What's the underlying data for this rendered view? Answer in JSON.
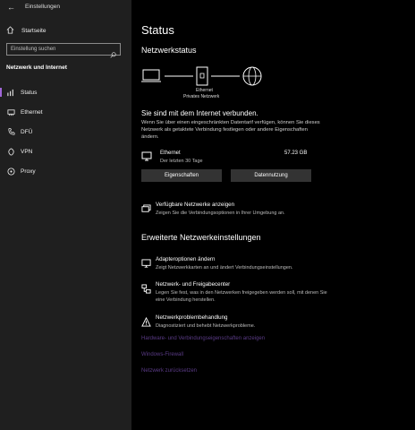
{
  "window": {
    "title": "Einstellungen",
    "back_glyph": "←"
  },
  "sidebar": {
    "home_label": "Startseite",
    "search_placeholder": "Einstellung suchen",
    "section_title": "Netzwerk und Internet",
    "items": [
      {
        "label": "Status",
        "icon": "status-icon",
        "active": true
      },
      {
        "label": "Ethernet",
        "icon": "ethernet-icon"
      },
      {
        "label": "DFÜ",
        "icon": "dialup-icon"
      },
      {
        "label": "VPN",
        "icon": "vpn-icon"
      },
      {
        "label": "Proxy",
        "icon": "proxy-icon"
      }
    ]
  },
  "main": {
    "title": "Status",
    "network_status_heading": "Netzwerkstatus",
    "diagram": {
      "caption_line1": "Ethernet",
      "caption_line2": "Privates Netzwerk"
    },
    "connected_text": "Sie sind mit dem Internet verbunden.",
    "connected_desc": "Wenn Sie über einen eingeschränkten Datentarif verfügen, können Sie dieses Netzwerk als getaktete Verbindung festlegen oder andere Eigenschaften ändern.",
    "ethernet": {
      "name": "Ethernet",
      "sub": "Der letzten 30 Tage",
      "size": "57.23 GB"
    },
    "buttons": {
      "properties": "Eigenschaften",
      "data_usage": "Datennutzung"
    },
    "available_networks": {
      "title": "Verfügbare Netzwerke anzeigen",
      "sub": "Zeigen Sie die Verbindungsoptionen in Ihrer Umgebung an."
    },
    "advanced_heading": "Erweiterte Netzwerkeinstellungen",
    "advanced_items": [
      {
        "title": "Adapteroptionen ändern",
        "sub": "Zeigt Netzwerkkarten an und ändert Verbindungseinstellungen."
      },
      {
        "title": "Netzwerk- und Freigabecenter",
        "sub": "Legen Sie fest, was in den Netzwerken freigegeben werden soll, mit denen Sie eine Verbindung herstellen."
      },
      {
        "title": "Netzwerkproblembehandlung",
        "sub": "Diagnostiziert und behebt Netzwerkprobleme."
      }
    ],
    "links": [
      "Hardware- und Verbindungseigenschaften anzeigen",
      "Windows-Firewall",
      "Netzwerk zurücksetzen"
    ]
  },
  "colors": {
    "accent": "#a066d8",
    "link": "#5a3b86",
    "sidebar_bg": "#1f1f1f",
    "button_bg": "#333333"
  }
}
